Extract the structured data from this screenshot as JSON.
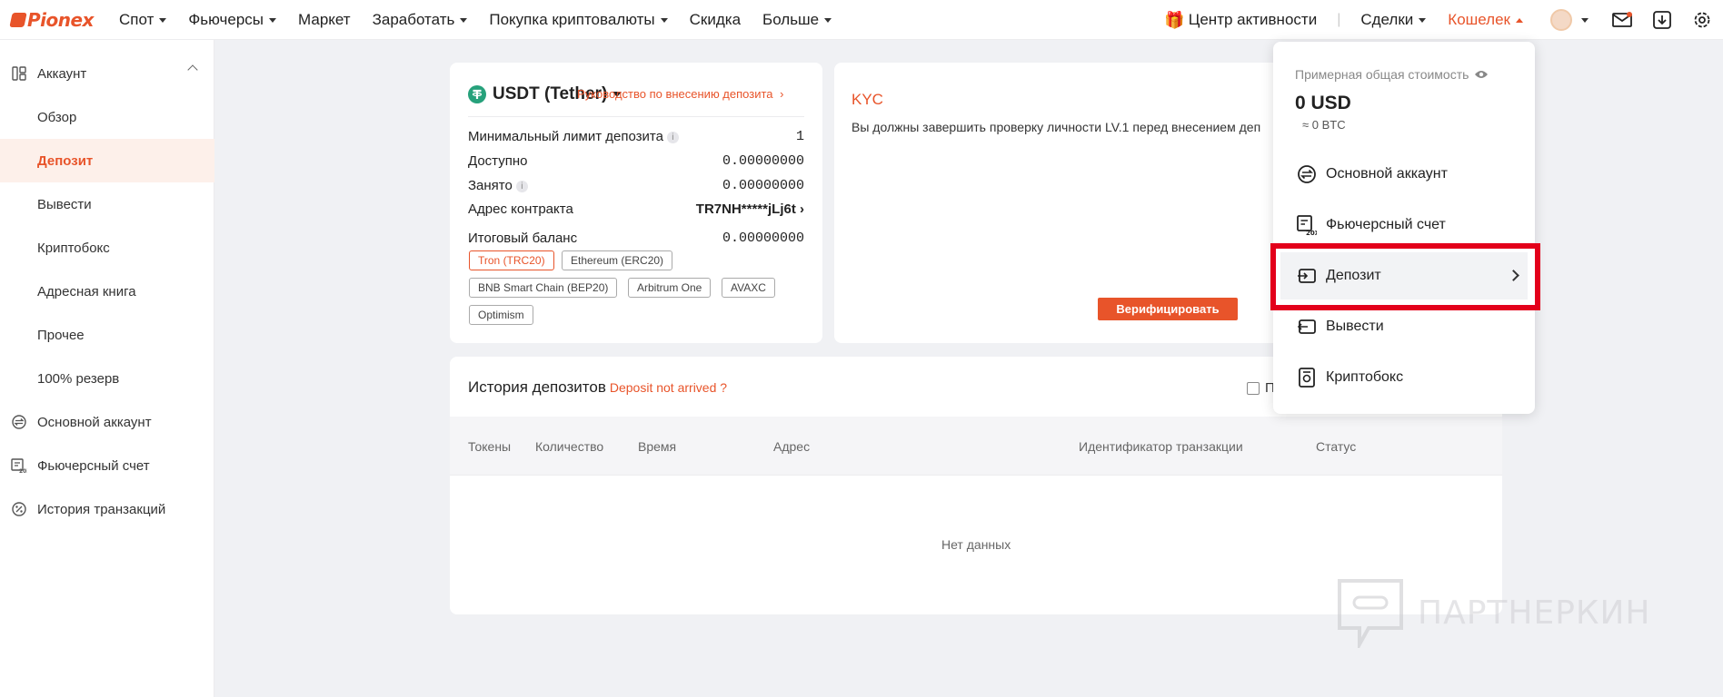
{
  "brand": {
    "name": "Pionex"
  },
  "nav": {
    "items": [
      {
        "label": "Спот",
        "caret": true
      },
      {
        "label": "Фьючерсы",
        "caret": true
      },
      {
        "label": "Маркет",
        "caret": false
      },
      {
        "label": "Заработать",
        "caret": true
      },
      {
        "label": "Покупка криптовалюты",
        "caret": true
      },
      {
        "label": "Скидка",
        "caret": false
      },
      {
        "label": "Больше",
        "caret": true
      }
    ],
    "activity": "Центр активности",
    "deals": "Сделки",
    "wallet": "Кошелек"
  },
  "sidebar": {
    "items": [
      {
        "label": "Аккаунт",
        "icon": "grid-icon"
      },
      {
        "label": "Обзор"
      },
      {
        "label": "Депозит"
      },
      {
        "label": "Вывести"
      },
      {
        "label": "Криптобокс"
      },
      {
        "label": "Адресная книга"
      },
      {
        "label": "Прочее"
      },
      {
        "label": "100% резерв"
      },
      {
        "label": "Основной аккаунт",
        "icon": "exchange-icon"
      },
      {
        "label": "Фьючерсный счет",
        "icon": "futures-icon"
      },
      {
        "label": "История транзакций",
        "icon": "percent-icon"
      }
    ]
  },
  "deposit": {
    "coin": "USDT (Tether)",
    "guide_link": "Руководство по внесению депозита",
    "min_limit_label": "Минимальный лимит депозита",
    "min_limit_value": "1",
    "available_label": "Доступно",
    "available_value": "0.00000000",
    "occupied_label": "Занято",
    "occupied_value": "0.00000000",
    "contract_label": "Адрес контракта",
    "contract_value": "TR7NH*****jLj6t",
    "total_label": "Итоговый баланс",
    "total_value": "0.00000000",
    "networks": [
      "Tron (TRC20)",
      "Ethereum (ERC20)",
      "BNB Smart Chain (BEP20)",
      "Arbitrum One",
      "AVAXC",
      "Optimism"
    ],
    "selected_network": "Tron (TRC20)"
  },
  "kyc": {
    "title": "KYC",
    "text": "Вы должны завершить проверку личности LV.1 перед внесением деп",
    "button": "Верифицировать"
  },
  "history": {
    "title": "История депозитов",
    "not_arrived": "Deposit not arrived ?",
    "checkbox_label": "П",
    "columns": [
      "Токены",
      "Количество",
      "Время",
      "Адрес",
      "Идентификатор транзакции",
      "Статус"
    ],
    "empty": "Нет данных"
  },
  "wallet_menu": {
    "total_label": "Примерная общая стоимость",
    "total_usd": "0 USD",
    "total_btc": "≈ 0 BTC",
    "items": [
      "Основной аккаунт",
      "Фьючерсный счет",
      "Депозит",
      "Вывести",
      "Криптобокс"
    ]
  },
  "watermark": "ПАРТНЕРКИН",
  "colors": {
    "accent": "#e8542a",
    "highlight": "#e3001b",
    "tether": "#26a17b"
  }
}
